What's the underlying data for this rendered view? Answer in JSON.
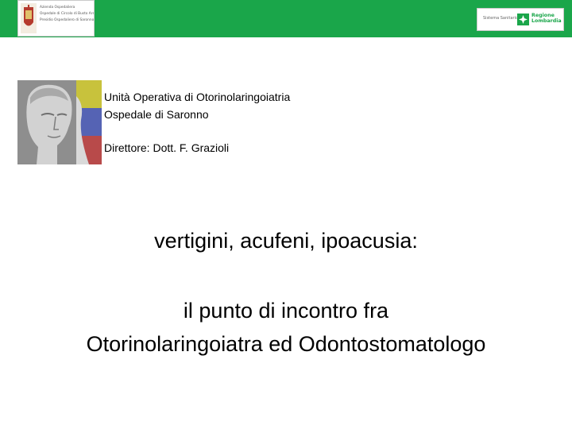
{
  "header": {
    "bar_color": "#1aa64a",
    "left_logo": {
      "icon": "crest-icon",
      "lines": [
        "Azienda Ospedaliera",
        "Ospedale di Circolo di Busto Arsizio",
        "Presidio Ospedaliero di Saronno"
      ]
    },
    "right_logo": {
      "system_text": "Sistema Sanitario",
      "icon": "regione-lombardia-icon",
      "region_line1": "Regione",
      "region_line2": "Lombardia"
    }
  },
  "image": {
    "name": "david-statue-image",
    "panel_colors": [
      "#c8c23c",
      "#5563b4",
      "#b84a4a"
    ]
  },
  "unit": {
    "line1": "Unità Operativa di Otorinolaringoiatria",
    "line2": "Ospedale di Saronno"
  },
  "director": "Direttore: Dott. F. Grazioli",
  "title": "vertigini, acufeni, ipoacusia:",
  "subtitle": {
    "line1": "il punto di incontro fra",
    "line2": "Otorinolaringoiatra ed Odontostomatologo"
  }
}
